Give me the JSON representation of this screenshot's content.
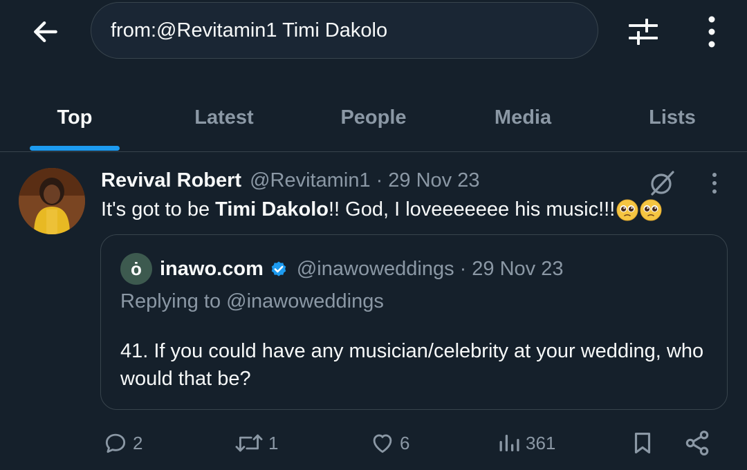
{
  "search": {
    "query": "from:@Revitamin1 Timi Dakolo"
  },
  "tabs": [
    {
      "label": "Top"
    },
    {
      "label": "Latest"
    },
    {
      "label": "People"
    },
    {
      "label": "Media"
    },
    {
      "label": "Lists"
    }
  ],
  "tweet": {
    "name": "Revival Robert",
    "handle": "@Revitamin1",
    "separator": "·",
    "date": "29 Nov 23",
    "text_before": "It's got to be ",
    "text_bold": "Timi Dakolo",
    "text_after": "!! God, I loveeeeeee his music!!!",
    "emojis": [
      "pleading-face",
      "pleading-face"
    ],
    "quote": {
      "avatar_letter": "ȯ",
      "name": "inawo.com",
      "handle": "@inawoweddings",
      "separator": "·",
      "date": "29 Nov 23",
      "replying_to": "Replying to @inawoweddings",
      "text": "41. If you could have any musician/celebrity at your wedding, who would that be?"
    },
    "stats": {
      "replies": "2",
      "reposts": "1",
      "likes": "6",
      "views": "361"
    }
  },
  "colors": {
    "background": "#15202b",
    "accent": "#1d9bf0",
    "muted": "#8b98a5",
    "border": "#38444d"
  }
}
